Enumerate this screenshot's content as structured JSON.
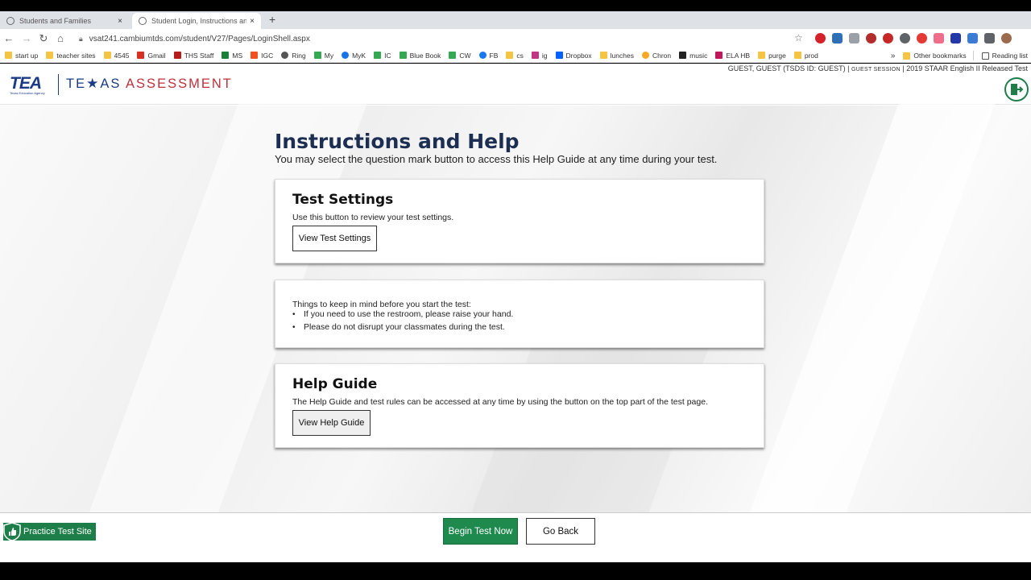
{
  "browser": {
    "tabs": [
      {
        "title": "Students and Families",
        "close": "×"
      },
      {
        "title": "Student Login, Instructions and",
        "close": "×"
      }
    ],
    "new_tab": "+",
    "url": "vsat241.cambiumtds.com/student/V27/Pages/LoginShell.aspx",
    "bookmarks": [
      "start up",
      "teacher sites",
      "4545",
      "Gmail",
      "THS Staff",
      "MS",
      "IGC",
      "Ring",
      "My",
      "MyK",
      "IC",
      "Blue Book",
      "CW",
      "FB",
      "cs",
      "ig",
      "Dropbox",
      "lunches",
      "Chron",
      "music",
      "ELA HB",
      "purge",
      "prod"
    ],
    "bookmarks_more": "»",
    "other_bookmarks": "Other bookmarks",
    "reading_list": "Reading list"
  },
  "header": {
    "tea_logo": "TEA",
    "tea_logo_sub": "Texas Education Agency",
    "texas_logo_pre": "TE",
    "texas_logo_post": "AS",
    "texas_logo_assess": "ASSESSMENT",
    "session_user": "GUEST, GUEST (TSDS ID: GUEST) |",
    "session_label": "GUEST SESSION",
    "session_test": "| 2019 STAAR English II Released Test"
  },
  "main": {
    "title": "Instructions and Help",
    "subtitle": "You may select the question mark button to access this Help Guide at any time during your test.",
    "settings_card": {
      "heading": "Test Settings",
      "text": "Use this button to review your test settings.",
      "button": "View Test Settings"
    },
    "reminders_card": {
      "intro": "Things to keep in mind before you start the test:",
      "items": [
        "If you need to use the restroom, please raise your hand.",
        "Please do not disrupt your classmates during the test."
      ]
    },
    "help_card": {
      "heading": "Help Guide",
      "text": "The Help Guide and test rules can be accessed at any time by using the button on the top part of the test page.",
      "button": "View Help Guide"
    }
  },
  "footer": {
    "practice_badge": "Practice Test Site",
    "begin_button": "Begin Test Now",
    "back_button": "Go Back"
  },
  "colors": {
    "brand_blue": "#1b3b87",
    "brand_red": "#c0303a",
    "brand_green": "#1e8a4e",
    "title_navy": "#1c2e52"
  }
}
